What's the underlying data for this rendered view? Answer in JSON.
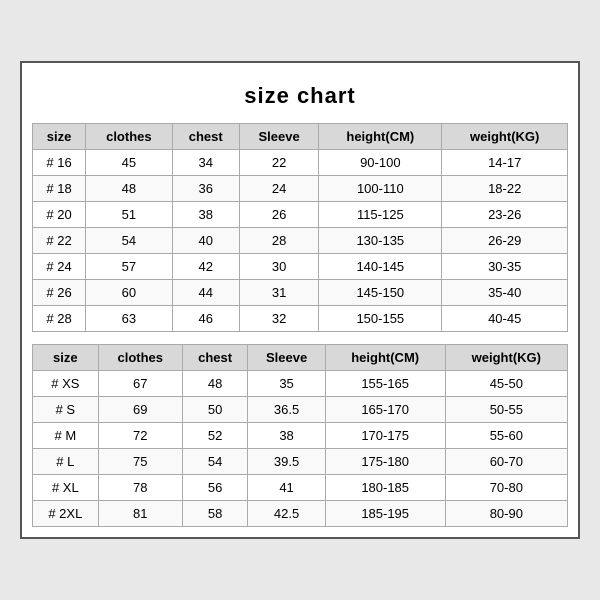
{
  "title": "size chart",
  "columns": [
    "size",
    "clothes",
    "chest",
    "Sleeve",
    "height(CM)",
    "weight(KG)"
  ],
  "table1": [
    [
      "# 16",
      "45",
      "34",
      "22",
      "90-100",
      "14-17"
    ],
    [
      "# 18",
      "48",
      "36",
      "24",
      "100-110",
      "18-22"
    ],
    [
      "# 20",
      "51",
      "38",
      "26",
      "115-125",
      "23-26"
    ],
    [
      "# 22",
      "54",
      "40",
      "28",
      "130-135",
      "26-29"
    ],
    [
      "# 24",
      "57",
      "42",
      "30",
      "140-145",
      "30-35"
    ],
    [
      "# 26",
      "60",
      "44",
      "31",
      "145-150",
      "35-40"
    ],
    [
      "# 28",
      "63",
      "46",
      "32",
      "150-155",
      "40-45"
    ]
  ],
  "table2": [
    [
      "# XS",
      "67",
      "48",
      "35",
      "155-165",
      "45-50"
    ],
    [
      "# S",
      "69",
      "50",
      "36.5",
      "165-170",
      "50-55"
    ],
    [
      "# M",
      "72",
      "52",
      "38",
      "170-175",
      "55-60"
    ],
    [
      "# L",
      "75",
      "54",
      "39.5",
      "175-180",
      "60-70"
    ],
    [
      "# XL",
      "78",
      "56",
      "41",
      "180-185",
      "70-80"
    ],
    [
      "# 2XL",
      "81",
      "58",
      "42.5",
      "185-195",
      "80-90"
    ]
  ]
}
